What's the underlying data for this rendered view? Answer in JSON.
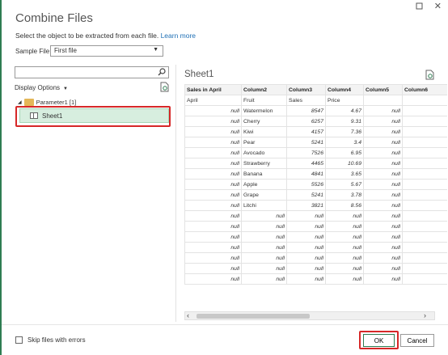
{
  "window": {
    "minimize_glyph": "?",
    "close_glyph": "✕"
  },
  "dialog": {
    "title": "Combine Files",
    "subtitle": "Select the object to be extracted from each file.",
    "learn_more": "Learn more",
    "sample_label": "Sample File:",
    "sample_value": "First file"
  },
  "left": {
    "search_placeholder": "",
    "display_options": "Display Options",
    "tree_parameter": "Parameter1 [1]",
    "tree_sheet": "Sheet1"
  },
  "preview": {
    "title": "Sheet1",
    "columns": [
      "Sales in April",
      "Column2",
      "Column3",
      "Column4",
      "Column5",
      "Column6"
    ],
    "rows": [
      [
        "April",
        "Fruit",
        "Sales",
        "Price",
        "",
        ""
      ],
      [
        "null",
        "Watermelon",
        "8547",
        "4.67",
        "null",
        "n"
      ],
      [
        "null",
        "Cherry",
        "6257",
        "9.31",
        "null",
        "n"
      ],
      [
        "null",
        "Kiwi",
        "4157",
        "7.36",
        "null",
        "n"
      ],
      [
        "null",
        "Pear",
        "5241",
        "3.4",
        "null",
        "n"
      ],
      [
        "null",
        "Avocado",
        "7526",
        "6.95",
        "null",
        "n"
      ],
      [
        "null",
        "Strawberry",
        "4465",
        "10.69",
        "null",
        "n"
      ],
      [
        "null",
        "Banana",
        "4841",
        "3.65",
        "null",
        "n"
      ],
      [
        "null",
        "Apple",
        "5526",
        "5.67",
        "null",
        "n"
      ],
      [
        "null",
        "Grape",
        "5241",
        "3.78",
        "null",
        "n"
      ],
      [
        "null",
        "Litchi",
        "3821",
        "8.56",
        "null",
        "n"
      ],
      [
        "null",
        "null",
        "null",
        "null",
        "null",
        "n"
      ],
      [
        "null",
        "null",
        "null",
        "null",
        "null",
        "n"
      ],
      [
        "null",
        "null",
        "null",
        "null",
        "null",
        "n"
      ],
      [
        "null",
        "null",
        "null",
        "null",
        "null",
        "n"
      ],
      [
        "null",
        "null",
        "null",
        "null",
        "null",
        "n"
      ],
      [
        "null",
        "null",
        "null",
        "null",
        "null",
        "n"
      ],
      [
        "null",
        "null",
        "null",
        "null",
        "null",
        "n"
      ]
    ]
  },
  "footer": {
    "skip_label": "Skip files with errors",
    "ok": "OK",
    "cancel": "Cancel"
  },
  "colors": {
    "accent": "#2e7d52",
    "highlight": "#d62828",
    "selected": "#d7eedf"
  }
}
